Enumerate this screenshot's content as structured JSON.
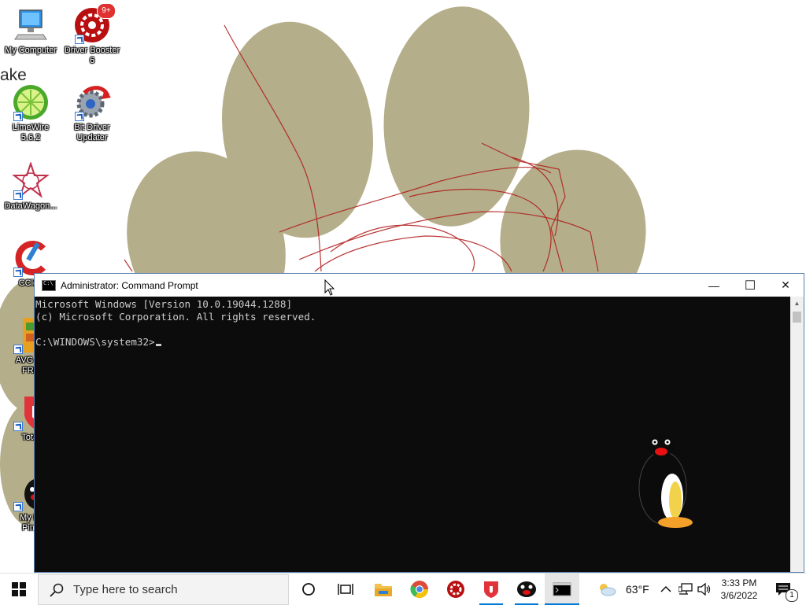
{
  "desktop": {
    "icons": [
      {
        "name": "my-computer",
        "label": "My Computer"
      },
      {
        "name": "driver-booster",
        "label": "Driver Booster\n6",
        "badge": "9+"
      },
      {
        "name": "limewire",
        "label": "LimeWire\n5.6.2"
      },
      {
        "name": "bit-driver-updater",
        "label": "Bit Driver\nUpdater"
      },
      {
        "name": "datawagon",
        "label": "DataWagon..."
      },
      {
        "name": "ccleaner",
        "label": "CClea"
      },
      {
        "name": "avg-antivirus",
        "label": "AVG An\nFRE"
      },
      {
        "name": "total",
        "label": "Total"
      },
      {
        "name": "my-friend-pingu",
        "label": "My Fr\nPing"
      }
    ],
    "partial_text": "ake"
  },
  "cmd_window": {
    "title": "Administrator: Command Prompt",
    "lines": [
      "Microsoft Windows [Version 10.0.19044.1288]",
      "(c) Microsoft Corporation. All rights reserved.",
      "",
      "C:\\WINDOWS\\system32>"
    ],
    "controls": {
      "minimize": "—",
      "maximize": "☐",
      "close": "✕"
    }
  },
  "taskbar": {
    "search_placeholder": "Type here to search",
    "weather_temp": "63°F",
    "time": "3:33 PM",
    "date": "3/6/2022",
    "notification_count": "1"
  },
  "colors": {
    "paw": "#b4ae8a",
    "scribble": "#b01818",
    "console_bg": "#0c0c0c",
    "console_text": "#cccccc",
    "accent": "#0078d4"
  }
}
